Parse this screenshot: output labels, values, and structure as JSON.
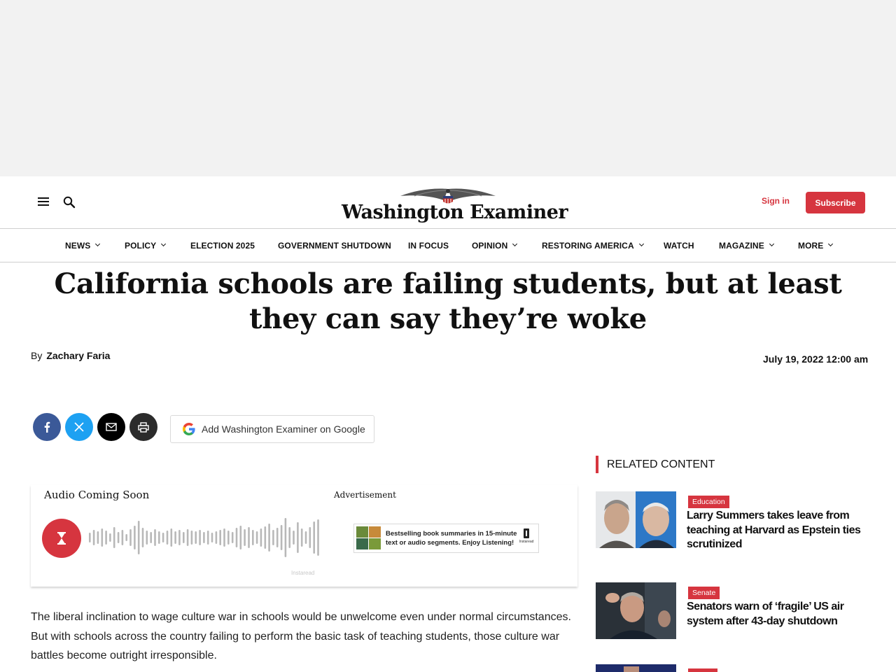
{
  "header": {
    "logo_text": "Washington Examiner",
    "sign_in": "Sign in",
    "subscribe": "Subscribe"
  },
  "nav": {
    "items": [
      {
        "label": "NEWS",
        "dropdown": true
      },
      {
        "label": "POLICY",
        "dropdown": true
      },
      {
        "label": "ELECTION 2025",
        "dropdown": false
      },
      {
        "label": "GOVERNMENT SHUTDOWN",
        "dropdown": false
      },
      {
        "label": "IN FOCUS",
        "dropdown": false
      },
      {
        "label": "OPINION",
        "dropdown": true
      },
      {
        "label": "RESTORING AMERICA",
        "dropdown": true
      },
      {
        "label": "WATCH",
        "dropdown": false
      },
      {
        "label": "MAGAZINE",
        "dropdown": true
      },
      {
        "label": "MORE",
        "dropdown": true
      }
    ]
  },
  "article": {
    "headline": "California schools are failing students, but at least they can say they’re woke",
    "by_prefix": "By",
    "author": "Zachary Faria",
    "date": "July 19, 2022 12:00 am",
    "body": "The liberal inclination to wage culture war in schools would be unwelcome even under normal circumstances. But with schools across the country failing to perform the basic task of teaching students, those culture war battles become outright irresponsible."
  },
  "share": {
    "google_button": "Add Washington Examiner on Google"
  },
  "audio": {
    "title": "Audio Coming Soon",
    "ad_label": "Advertisement",
    "ad_text_line1": "Bestselling book summaries in 15-minute",
    "ad_text_line2": "text or audio segments. Enjoy Listening!",
    "ad_brand": "Instaread",
    "watermark": "Instaread"
  },
  "related": {
    "heading": "RELATED CONTENT",
    "items": [
      {
        "badge": "Education",
        "title": "Larry Summers takes leave from teaching at Harvard as Epstein ties scrutinized"
      },
      {
        "badge": "Senate",
        "title": "Senators warn of ‘fragile’ US air system after 43-day shutdown"
      }
    ]
  },
  "colors": {
    "accent": "#d6353f",
    "facebook": "#3b5998",
    "x": "#1da1f2"
  },
  "icons": [
    "menu-icon",
    "search-icon",
    "facebook-icon",
    "x-icon",
    "email-icon",
    "print-icon",
    "google-icon",
    "hourglass-icon"
  ]
}
